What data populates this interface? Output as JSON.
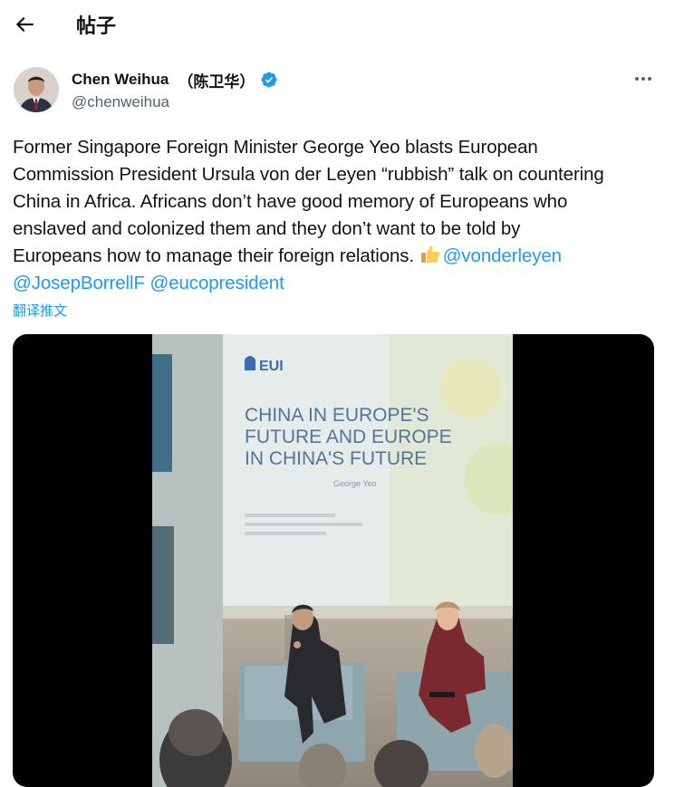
{
  "header": {
    "title": "帖子"
  },
  "author": {
    "name": "Chen Weihua",
    "name_cn": "（陈卫华）",
    "handle": "@chenweihua"
  },
  "tweet": {
    "line1": "Former Singapore Foreign Minister George Yeo blasts European",
    "line2": "Commission President Ursula von der Leyen “rubbish” talk on countering",
    "line3": "China in Africa.  Africans don’t have good memory of Europeans who",
    "line4": "enslaved and colonized them and they don’t want to be told by",
    "line5_text": "Europeans how to manage their foreign relations. ",
    "mention1": "@vonderleyen",
    "mention2": "@JosepBorrellF",
    "mention3": "@eucopresident"
  },
  "translate_label": "翻译推文",
  "video": {
    "logo": "EUI",
    "slide_line1": "CHINA IN EUROPE'S",
    "slide_line2": "FUTURE AND EUROPE",
    "slide_line3": "IN CHINA'S FUTURE",
    "slide_sub": "George Yeo"
  },
  "colors": {
    "accent": "#1d9bf0",
    "secondary_text": "#536471",
    "text": "#0f1419"
  },
  "icons": [
    "back-arrow-icon",
    "verified-badge-icon",
    "more-icon",
    "thumbs-up-icon"
  ]
}
